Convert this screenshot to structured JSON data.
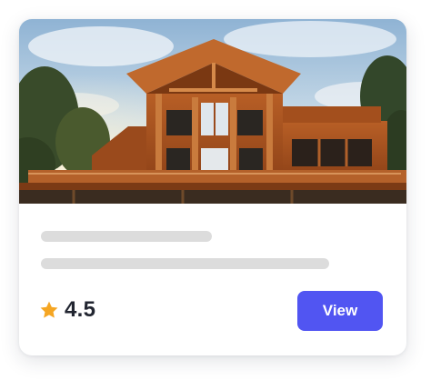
{
  "card": {
    "rating": {
      "value": "4.5",
      "icon": "star-icon",
      "star_color": "#f5a623"
    },
    "view_button": {
      "label": "View",
      "color": "#5155f2"
    },
    "placeholder_line_color": "#dcdcdc"
  }
}
